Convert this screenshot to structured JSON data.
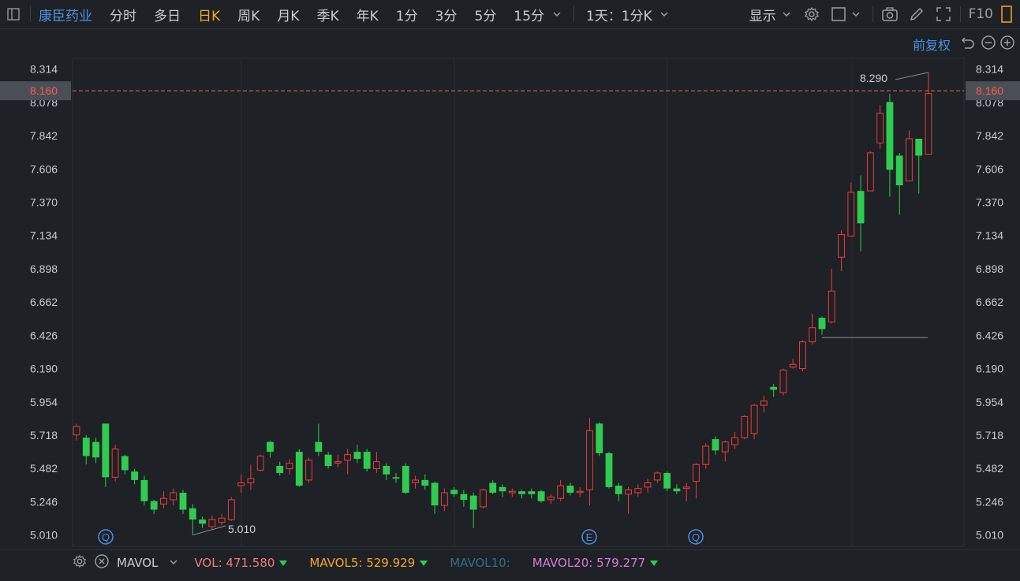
{
  "toolbar": {
    "stock_name": "康臣药业",
    "tabs": [
      "分时",
      "多日",
      "日K",
      "周K",
      "月K",
      "季K",
      "年K",
      "1分",
      "3分",
      "5分",
      "15分"
    ],
    "active_tab": "日K",
    "period_select": "1天：1分K",
    "display": "显示",
    "f10": "F10"
  },
  "subbar": {
    "adjust": "前复权"
  },
  "indicator": {
    "name": "MAVOL",
    "vol": "VOL: 471.580",
    "mavol5": "MAVOL5: 529.929",
    "mavol10": "MAVOL10:",
    "mavol20": "MAVOL20: 579.277"
  },
  "colors": {
    "up": "#f03b3b",
    "down": "#2fcc51",
    "bg": "#1e2125",
    "grid": "#2c3036",
    "accent": "#4a90e2"
  },
  "chart_data": {
    "type": "candlestick",
    "ylim": [
      4.93,
      8.39
    ],
    "yticks": [
      "8.314",
      "8.078",
      "7.842",
      "7.606",
      "7.370",
      "7.134",
      "6.898",
      "6.662",
      "6.426",
      "6.190",
      "5.954",
      "5.718",
      "5.482",
      "5.246",
      "5.010"
    ],
    "last_price": "8.160",
    "max_label": "8.290",
    "min_label": "5.010",
    "event_markers": [
      "Q",
      "E",
      "Q"
    ],
    "candles": [
      [
        5.72,
        5.78,
        5.8,
        5.68
      ],
      [
        5.7,
        5.57,
        5.72,
        5.51
      ],
      [
        5.67,
        5.56,
        5.7,
        5.52
      ],
      [
        5.8,
        5.42,
        5.8,
        5.35
      ],
      [
        5.42,
        5.62,
        5.65,
        5.39
      ],
      [
        5.57,
        5.47,
        5.58,
        5.44
      ],
      [
        5.46,
        5.4,
        5.48,
        5.37
      ],
      [
        5.4,
        5.25,
        5.43,
        5.22
      ],
      [
        5.25,
        5.19,
        5.26,
        5.16
      ],
      [
        5.23,
        5.27,
        5.32,
        5.2
      ],
      [
        5.26,
        5.31,
        5.34,
        5.22
      ],
      [
        5.31,
        5.19,
        5.33,
        5.16
      ],
      [
        5.2,
        5.12,
        5.23,
        5.01
      ],
      [
        5.12,
        5.09,
        5.14,
        5.06
      ],
      [
        5.07,
        5.12,
        5.15,
        5.05
      ],
      [
        5.1,
        5.13,
        5.16,
        5.08
      ],
      [
        5.12,
        5.26,
        5.28,
        5.11
      ],
      [
        5.36,
        5.38,
        5.44,
        5.31
      ],
      [
        5.38,
        5.41,
        5.51,
        5.33
      ],
      [
        5.47,
        5.57,
        5.58,
        5.46
      ],
      [
        5.67,
        5.6,
        5.68,
        5.56
      ],
      [
        5.5,
        5.45,
        5.53,
        5.43
      ],
      [
        5.48,
        5.52,
        5.55,
        5.44
      ],
      [
        5.6,
        5.36,
        5.62,
        5.35
      ],
      [
        5.4,
        5.54,
        5.56,
        5.38
      ],
      [
        5.67,
        5.6,
        5.8,
        5.57
      ],
      [
        5.58,
        5.5,
        5.6,
        5.48
      ],
      [
        5.52,
        5.53,
        5.58,
        5.49
      ],
      [
        5.54,
        5.58,
        5.62,
        5.44
      ],
      [
        5.6,
        5.55,
        5.65,
        5.52
      ],
      [
        5.6,
        5.48,
        5.62,
        5.46
      ],
      [
        5.48,
        5.53,
        5.6,
        5.45
      ],
      [
        5.5,
        5.44,
        5.52,
        5.4
      ],
      [
        5.42,
        5.41,
        5.45,
        5.38
      ],
      [
        5.5,
        5.31,
        5.52,
        5.3
      ],
      [
        5.38,
        5.4,
        5.43,
        5.34
      ],
      [
        5.4,
        5.36,
        5.44,
        5.33
      ],
      [
        5.38,
        5.22,
        5.39,
        5.16
      ],
      [
        5.22,
        5.31,
        5.34,
        5.18
      ],
      [
        5.33,
        5.3,
        5.35,
        5.28
      ],
      [
        5.3,
        5.26,
        5.33,
        5.21
      ],
      [
        5.29,
        5.19,
        5.31,
        5.06
      ],
      [
        5.21,
        5.33,
        5.34,
        5.2
      ],
      [
        5.38,
        5.31,
        5.4,
        5.3
      ],
      [
        5.35,
        5.32,
        5.37,
        5.28
      ],
      [
        5.31,
        5.32,
        5.34,
        5.28
      ],
      [
        5.32,
        5.3,
        5.33,
        5.27
      ],
      [
        5.32,
        5.3,
        5.34,
        5.27
      ],
      [
        5.32,
        5.25,
        5.33,
        5.24
      ],
      [
        5.26,
        5.28,
        5.3,
        5.23
      ],
      [
        5.27,
        5.36,
        5.4,
        5.25
      ],
      [
        5.36,
        5.31,
        5.38,
        5.29
      ],
      [
        5.32,
        5.32,
        5.35,
        5.28
      ],
      [
        5.33,
        5.75,
        5.84,
        5.22
      ],
      [
        5.8,
        5.59,
        5.81,
        5.57
      ],
      [
        5.59,
        5.35,
        5.6,
        5.34
      ],
      [
        5.36,
        5.3,
        5.38,
        5.25
      ],
      [
        5.3,
        5.33,
        5.35,
        5.16
      ],
      [
        5.31,
        5.34,
        5.37,
        5.28
      ],
      [
        5.35,
        5.38,
        5.41,
        5.31
      ],
      [
        5.4,
        5.45,
        5.46,
        5.38
      ],
      [
        5.45,
        5.34,
        5.46,
        5.32
      ],
      [
        5.34,
        5.32,
        5.37,
        5.3
      ],
      [
        5.34,
        5.35,
        5.38,
        5.25
      ],
      [
        5.39,
        5.51,
        5.52,
        5.27
      ],
      [
        5.51,
        5.64,
        5.66,
        5.48
      ],
      [
        5.69,
        5.61,
        5.71,
        5.58
      ],
      [
        5.6,
        5.67,
        5.68,
        5.53
      ],
      [
        5.65,
        5.7,
        5.74,
        5.62
      ],
      [
        5.7,
        5.85,
        5.86,
        5.69
      ],
      [
        5.73,
        5.93,
        5.94,
        5.69
      ],
      [
        5.93,
        5.96,
        6.0,
        5.88
      ],
      [
        6.06,
        6.04,
        6.08,
        5.99
      ],
      [
        6.02,
        6.18,
        6.19,
        6.0
      ],
      [
        6.2,
        6.22,
        6.26,
        6.19
      ],
      [
        6.19,
        6.38,
        6.39,
        6.17
      ],
      [
        6.38,
        6.48,
        6.58,
        6.36
      ],
      [
        6.55,
        6.47,
        6.56,
        6.43
      ],
      [
        6.52,
        6.74,
        6.9,
        6.51
      ],
      [
        6.98,
        7.14,
        7.17,
        6.88
      ],
      [
        7.13,
        7.44,
        7.51,
        7.13
      ],
      [
        7.45,
        7.22,
        7.56,
        7.02
      ],
      [
        7.45,
        7.72,
        7.73,
        7.45
      ],
      [
        7.79,
        8.0,
        8.06,
        7.75
      ],
      [
        8.08,
        7.6,
        8.14,
        7.41
      ],
      [
        7.7,
        7.49,
        7.72,
        7.28
      ],
      [
        7.52,
        7.82,
        7.88,
        7.52
      ],
      [
        7.82,
        7.7,
        7.82,
        7.43
      ],
      [
        7.71,
        8.14,
        8.29,
        7.71
      ]
    ]
  }
}
